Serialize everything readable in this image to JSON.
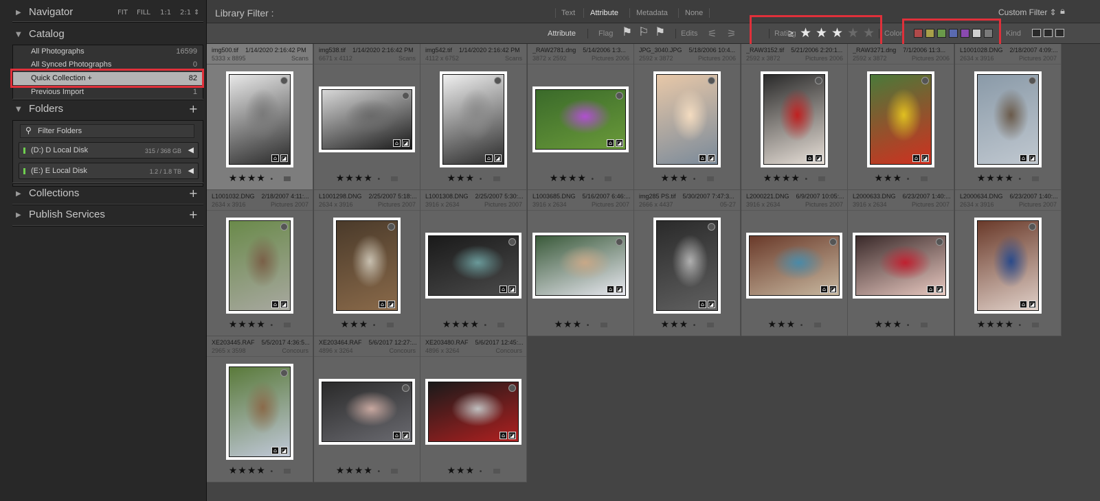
{
  "navigator": {
    "title": "Navigator",
    "zoom": [
      "FIT",
      "FILL",
      "1:1",
      "2:1"
    ]
  },
  "catalog": {
    "title": "Catalog",
    "items": [
      {
        "label": "All Photographs",
        "count": "16599"
      },
      {
        "label": "All Synced Photographs",
        "count": "0"
      },
      {
        "label": "Quick Collection  +",
        "count": "82"
      },
      {
        "label": "Previous Import",
        "count": "1"
      }
    ]
  },
  "folders": {
    "title": "Folders",
    "filter_placeholder": "Filter Folders",
    "volumes": [
      {
        "name": "(D:) D Local Disk",
        "size": "315 / 368 GB"
      },
      {
        "name": "(E:) E Local Disk",
        "size": "1.2 / 1.8 TB"
      }
    ]
  },
  "collections": {
    "title": "Collections"
  },
  "publish": {
    "title": "Publish Services"
  },
  "library_filter": {
    "label": "Library Filter :",
    "tabs": [
      "Text",
      "Attribute",
      "Metadata",
      "None"
    ],
    "preset": "Custom Filter"
  },
  "attribute_bar": {
    "attribute_label": "Attribute",
    "flag_label": "Flag",
    "edits_label": "Edits",
    "rating_label": "Rating",
    "rating_op": "≥",
    "rating_value": 3,
    "color_label": "Color",
    "kind_label": "Kind",
    "swatches": [
      "#b04a4a",
      "#a8a04a",
      "#6a9a4a",
      "#5a6ab0",
      "#8a4ab0",
      "#cfcfcf",
      "#7a7a7a"
    ]
  },
  "photos": [
    {
      "name": "img500.tif",
      "date": "1/14/2020 2:16:42 PM",
      "dims": "5333 x 8895",
      "folder": "Scans",
      "stars": 4,
      "selected": true,
      "orient": "p",
      "colors": [
        "#e8e8e8",
        "#7a7a7a",
        "#2a2a2a"
      ]
    },
    {
      "name": "img538.tif",
      "date": "1/14/2020 2:16:42 PM",
      "dims": "6671 x 4112",
      "folder": "Scans",
      "stars": 4,
      "orient": "l",
      "colors": [
        "#d8d8d8",
        "#6a6a6a",
        "#1a1a1a"
      ]
    },
    {
      "name": "img542.tif",
      "date": "1/14/2020 2:16:42 PM",
      "dims": "4112 x 6752",
      "folder": "Scans",
      "stars": 3,
      "orient": "p",
      "colors": [
        "#f0f0f0",
        "#8a8a8a",
        "#2a2a2a"
      ]
    },
    {
      "name": "_RAW2781.dng",
      "date": "5/14/2006 1:3...",
      "dims": "3872 x 2592",
      "folder": "Pictures 2006",
      "stars": 4,
      "orient": "l",
      "colors": [
        "#3a6a2a",
        "#b050d0",
        "#6a9a3a"
      ]
    },
    {
      "name": "JPG_3040.JPG",
      "date": "5/18/2006 10:4...",
      "dims": "2592 x 3872",
      "folder": "Pictures 2006",
      "stars": 3,
      "orient": "p",
      "colors": [
        "#e8c8a8",
        "#f4dcc0",
        "#7a8a9a"
      ]
    },
    {
      "name": "_RAW3152.tif",
      "date": "5/21/2006 2:20:1...",
      "dims": "2592 x 3872",
      "folder": "Pictures 2006",
      "stars": 4,
      "orient": "p",
      "colors": [
        "#2a2a2a",
        "#c02020",
        "#e8e0d8"
      ]
    },
    {
      "name": "_RAW3271.dng",
      "date": "7/1/2006 11:3...",
      "dims": "2592 x 3872",
      "folder": "Pictures 2006",
      "stars": 3,
      "orient": "p",
      "colors": [
        "#4a7a3a",
        "#e0c020",
        "#d03020"
      ]
    },
    {
      "name": "L1001028.DNG",
      "date": "2/18/2007 4:09:...",
      "dims": "2634 x 3916",
      "folder": "Pictures 2007",
      "stars": 4,
      "orient": "p",
      "colors": [
        "#8a9aa8",
        "#6a5a4a",
        "#c0c8d0"
      ]
    },
    {
      "name": "L1001032.DNG",
      "date": "2/18/2007 4:11:...",
      "dims": "2634 x 3916",
      "folder": "Pictures 2007",
      "stars": 4,
      "orient": "p",
      "colors": [
        "#6a8a4a",
        "#7a6048",
        "#a8a8a0"
      ]
    },
    {
      "name": "L1001298.DNG",
      "date": "2/25/2007 5:18:...",
      "dims": "2634 x 3916",
      "folder": "Pictures 2007",
      "stars": 3,
      "orient": "p",
      "colors": [
        "#4a3a2a",
        "#c8c0b0",
        "#8a6a4a"
      ]
    },
    {
      "name": "L1001308.DNG",
      "date": "2/25/2007 5:30:...",
      "dims": "3916 x 2634",
      "folder": "Pictures 2007",
      "stars": 4,
      "orient": "l",
      "colors": [
        "#1a1a1a",
        "#6a9a9a",
        "#4a4a4a"
      ]
    },
    {
      "name": "L1003685.DNG",
      "date": "5/16/2007 6:46:...",
      "dims": "3916 x 2634",
      "folder": "Pictures 2007",
      "stars": 3,
      "orient": "l",
      "colors": [
        "#3a5a3a",
        "#c8a888",
        "#e8e8f0"
      ]
    },
    {
      "name": "img285 PS.tif",
      "date": "5/30/2007 7:47:3...",
      "dims": "2666 x 4437",
      "folder": "05-27",
      "stars": 3,
      "orient": "p",
      "colors": [
        "#2a2a2a",
        "#b0b0b0",
        "#606060"
      ]
    },
    {
      "name": "L2000221.DNG",
      "date": "6/9/2007 10:05:...",
      "dims": "3916 x 2634",
      "folder": "Pictures 2007",
      "stars": 3,
      "orient": "l",
      "colors": [
        "#6a3a2a",
        "#4a8aa8",
        "#c8b8a0"
      ]
    },
    {
      "name": "L2000633.DNG",
      "date": "6/23/2007 1:40:...",
      "dims": "3916 x 2634",
      "folder": "Pictures 2007",
      "stars": 3,
      "orient": "l",
      "colors": [
        "#3a2a2a",
        "#c02030",
        "#e8c8c0"
      ]
    },
    {
      "name": "L2000634.DNG",
      "date": "6/23/2007 1:40:...",
      "dims": "2634 x 3916",
      "folder": "Pictures 2007",
      "stars": 4,
      "orient": "p",
      "colors": [
        "#6a3a2a",
        "#2a4a8a",
        "#e0d0c8"
      ]
    },
    {
      "name": "XE203445.RAF",
      "date": "5/5/2017 4:36:5...",
      "dims": "2965 x 3598",
      "folder": "Concours",
      "stars": 4,
      "orient": "p",
      "colors": [
        "#5a7a3a",
        "#8a6a4a",
        "#c0c8d8"
      ]
    },
    {
      "name": "XE203464.RAF",
      "date": "5/6/2017 12:27:...",
      "dims": "4896 x 3264",
      "folder": "Concours",
      "stars": 4,
      "orient": "l",
      "colors": [
        "#2a2a2a",
        "#c8a8a0",
        "#6a6a70"
      ]
    },
    {
      "name": "XE203480.RAF",
      "date": "5/6/2017 12:45:...",
      "dims": "4896 x 3264",
      "folder": "Concours",
      "stars": 3,
      "orient": "l",
      "colors": [
        "#1a1a1a",
        "#c0c0c0",
        "#b02020"
      ]
    }
  ]
}
